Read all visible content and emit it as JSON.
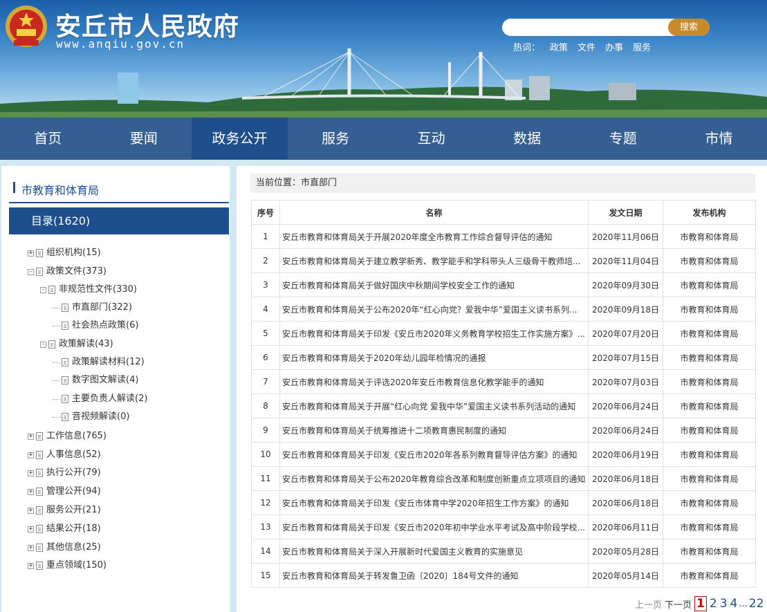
{
  "header": {
    "site_title": "安丘市人民政府",
    "site_url": "www.anqiu.gov.cn",
    "search_placeholder": "",
    "search_button": "搜索",
    "hotwords_label": "热词：",
    "hotwords": [
      "政策",
      "文件",
      "办事",
      "服务"
    ]
  },
  "nav": {
    "items": [
      "首页",
      "要闻",
      "政务公开",
      "服务",
      "互动",
      "数据",
      "专题",
      "市情"
    ],
    "active_index": 2
  },
  "sidebar": {
    "title": "市教育和体育局",
    "catalog": "目录(1620)",
    "tree": [
      {
        "label": "组织机构(15)",
        "level": 0,
        "expander": "+"
      },
      {
        "label": "政策文件(373)",
        "level": 0,
        "expander": "−"
      },
      {
        "label": "非规范性文件(330)",
        "level": 1,
        "expander": "−"
      },
      {
        "label": "市直部门(322)",
        "level": 2,
        "expander": ""
      },
      {
        "label": "社会热点政策(6)",
        "level": 2,
        "expander": ""
      },
      {
        "label": "政策解读(43)",
        "level": 1,
        "expander": "−"
      },
      {
        "label": "政策解读材料(12)",
        "level": 2,
        "expander": ""
      },
      {
        "label": "数字图文解读(4)",
        "level": 2,
        "expander": ""
      },
      {
        "label": "主要负责人解读(2)",
        "level": 2,
        "expander": ""
      },
      {
        "label": "音视频解读(0)",
        "level": 2,
        "expander": ""
      },
      {
        "label": "工作信息(765)",
        "level": 0,
        "expander": "+"
      },
      {
        "label": "人事信息(52)",
        "level": 0,
        "expander": "+"
      },
      {
        "label": "执行公开(79)",
        "level": 0,
        "expander": "+"
      },
      {
        "label": "管理公开(94)",
        "level": 0,
        "expander": "+"
      },
      {
        "label": "服务公开(21)",
        "level": 0,
        "expander": "+"
      },
      {
        "label": "结果公开(18)",
        "level": 0,
        "expander": "+"
      },
      {
        "label": "其他信息(25)",
        "level": 0,
        "expander": "+"
      },
      {
        "label": "重点领域(150)",
        "level": 0,
        "expander": "+"
      }
    ]
  },
  "main": {
    "breadcrumb": "当前位置：市直部门",
    "columns": [
      "序号",
      "名称",
      "发文日期",
      "发布机构"
    ],
    "rows": [
      [
        "1",
        "安丘市教育和体育局关于开展2020年度全市教育工作综合督导评估的通知",
        "2020年11月06日",
        "市教育和体育局"
      ],
      [
        "2",
        "安丘市教育和体育局关于建立教学新秀、教学能手和学科带头人三级骨干教师培...",
        "2020年11月04日",
        "市教育和体育局"
      ],
      [
        "3",
        "安丘市教育和体育局关于做好国庆中秋期间学校安全工作的通知",
        "2020年09月30日",
        "市教育和体育局"
      ],
      [
        "4",
        "安丘市教育和体育局关于公布2020年“红心向党？爱我中华”爱国主义读书系列...",
        "2020年09月18日",
        "市教育和体育局"
      ],
      [
        "5",
        "安丘市教育和体育局关于印发《安丘市2020年义务教育学校招生工作实施方案》...",
        "2020年07月20日",
        "市教育和体育局"
      ],
      [
        "6",
        "安丘市教育和体育局关于2020年幼儿园年检情况的通报",
        "2020年07月15日",
        "市教育和体育局"
      ],
      [
        "7",
        "安丘市教育和体育局关于评选2020年安丘市教育信息化教学能手的通知",
        "2020年07月03日",
        "市教育和体育局"
      ],
      [
        "8",
        "安丘市教育和体育局关于开展“红心向党 爱我中华”爱国主义读书系列活动的通知",
        "2020年06月24日",
        "市教育和体育局"
      ],
      [
        "9",
        "安丘市教育和体育局关于统筹推进十二项教育惠民制度的通知",
        "2020年06月24日",
        "市教育和体育局"
      ],
      [
        "10",
        "安丘市教育和体育局关于印发《安丘市2020年各系列教育督导评估方案》的通知",
        "2020年06月19日",
        "市教育和体育局"
      ],
      [
        "11",
        "安丘市教育和体育局关于公布2020年教育综合改革和制度创新重点立项项目的通知",
        "2020年06月18日",
        "市教育和体育局"
      ],
      [
        "12",
        "安丘市教育和体育局关于印发《安丘市体育中学2020年招生工作方案》的通知",
        "2020年06月18日",
        "市教育和体育局"
      ],
      [
        "13",
        "安丘市教育和体育局关于印发《安丘市2020年初中学业水平考试及高中阶段学校...",
        "2020年06月11日",
        "市教育和体育局"
      ],
      [
        "14",
        "安丘市教育和体育局关于深入开展新时代爱国主义教育的实施意见",
        "2020年05月28日",
        "市教育和体育局"
      ],
      [
        "15",
        "安丘市教育和体育局关于转发鲁卫函〔2020〕184号文件的通知",
        "2020年05月14日",
        "市教育和体育局"
      ]
    ],
    "pager": {
      "prev": "上一页",
      "next": "下一页",
      "pages": [
        "1",
        "2",
        "3",
        "4"
      ],
      "ellipsis": "...",
      "last": "22",
      "current": "1"
    }
  },
  "colors": {
    "nav_bg": "#355f93",
    "nav_active": "#1e4f8c",
    "accent": "#1d4f8d",
    "search_button": "#c98a2c",
    "page_bg": "#d2e8f3"
  }
}
